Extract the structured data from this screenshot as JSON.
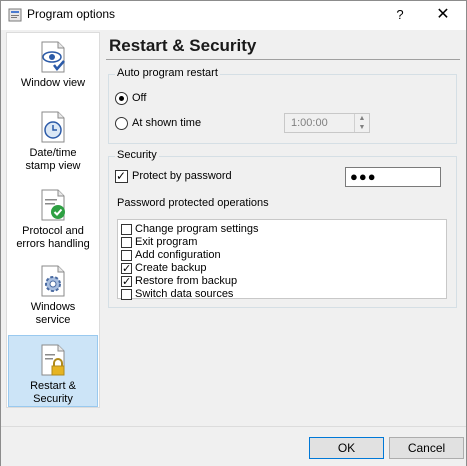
{
  "window": {
    "title": "Program options"
  },
  "titlebar": {
    "help": "?",
    "close": "✕"
  },
  "sidebar": {
    "items": [
      {
        "label": "Window view"
      },
      {
        "label": "Date/time stamp view"
      },
      {
        "label": "Protocol and errors handling"
      },
      {
        "label": "Windows service"
      },
      {
        "label": "Restart & Security"
      }
    ],
    "active_index": 4
  },
  "main": {
    "title": "Restart & Security",
    "auto_restart": {
      "group_label": "Auto program restart",
      "off_label": "Off",
      "at_time_label": "At shown time",
      "selected": "Off",
      "time_value": "1:00:00"
    },
    "security": {
      "group_label": "Security",
      "protect_label": "Protect by password",
      "protect_checked": true,
      "password_display": "●●●",
      "ops_label": "Password protected operations",
      "operations": [
        {
          "label": "Change program settings",
          "checked": false
        },
        {
          "label": "Exit program",
          "checked": false
        },
        {
          "label": "Add configuration",
          "checked": false
        },
        {
          "label": "Create backup",
          "checked": true
        },
        {
          "label": "Restore from backup",
          "checked": true
        },
        {
          "label": "Switch data sources",
          "checked": false
        }
      ]
    }
  },
  "buttons": {
    "ok": "OK",
    "cancel": "Cancel"
  },
  "colors": {
    "active_item_bg": "#cce4f7",
    "active_item_border": "#99c9ef",
    "accent": "#0078d7"
  }
}
